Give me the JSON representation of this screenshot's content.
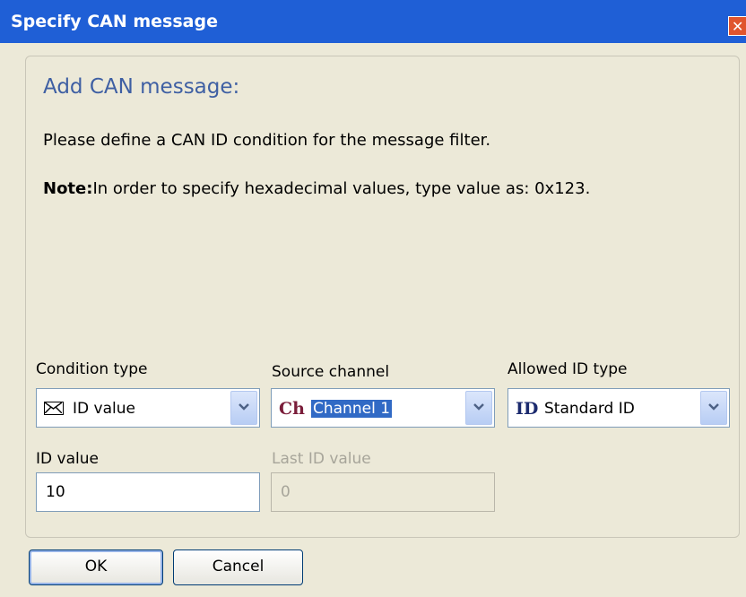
{
  "window": {
    "title": "Specify CAN message"
  },
  "heading": "Add CAN message:",
  "description": "Please define a CAN ID condition for the message filter.",
  "note": {
    "bold": "Note:",
    "text": "In order to specify hexadecimal values, type value as: 0x123."
  },
  "condition_type": {
    "label": "Condition type",
    "value": "ID value",
    "icon": "envelope-icon"
  },
  "source_channel": {
    "label": "Source channel",
    "prefix": "Ch",
    "value": "Channel 1"
  },
  "allowed_id_type": {
    "label": "Allowed ID type",
    "prefix": "ID",
    "value": "Standard ID"
  },
  "id_value": {
    "label": "ID value",
    "value": "10"
  },
  "last_id_value": {
    "label": "Last ID value",
    "value": "0"
  },
  "buttons": {
    "ok": "OK",
    "cancel": "Cancel"
  },
  "colors": {
    "titlebar": "#1f5fd6",
    "heading": "#3e5fa3",
    "selection": "#316ac5"
  }
}
